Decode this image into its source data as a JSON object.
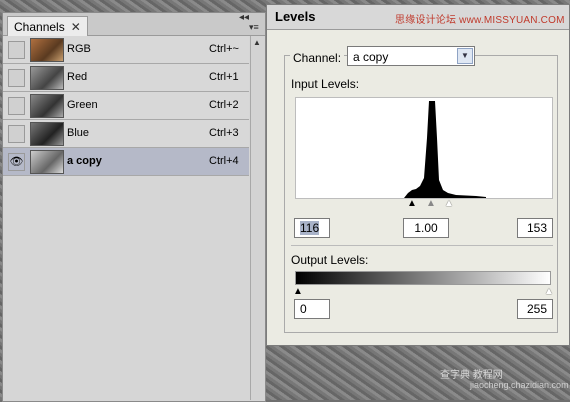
{
  "channels_panel": {
    "tab_label": "Channels",
    "close_glyph": "✕",
    "rows": [
      {
        "name": "RGB",
        "shortcut": "Ctrl+~",
        "visible": false,
        "selected": false,
        "thumb_color": "#8a5a3a"
      },
      {
        "name": "Red",
        "shortcut": "Ctrl+1",
        "visible": false,
        "selected": false,
        "thumb_color": "#7a7a7a"
      },
      {
        "name": "Green",
        "shortcut": "Ctrl+2",
        "visible": false,
        "selected": false,
        "thumb_color": "#6a6a6a"
      },
      {
        "name": "Blue",
        "shortcut": "Ctrl+3",
        "visible": false,
        "selected": false,
        "thumb_color": "#5a5a5a"
      },
      {
        "name": "a copy",
        "shortcut": "Ctrl+4",
        "visible": true,
        "selected": true,
        "thumb_color": "#a0a0a0"
      }
    ],
    "eye_glyph": "👁"
  },
  "levels_dialog": {
    "title": "Levels",
    "watermark": "思缘设计论坛 www.MISSYUAN.COM",
    "channel_label": "Channel:",
    "channel_value": "a copy",
    "input_levels_label": "Input Levels:",
    "input_black": "116",
    "input_gamma": "1.00",
    "input_white": "153",
    "output_levels_label": "Output Levels:",
    "output_black": "0",
    "output_white": "255"
  },
  "corner_watermark": {
    "line1": "查字典 教程网",
    "line2": "jiaocheng.chazidian.com"
  },
  "colors": {
    "selected_row": "#b5b9c8",
    "dialog_bg": "#ebebe3",
    "panel_bg": "#d6d6d6"
  }
}
